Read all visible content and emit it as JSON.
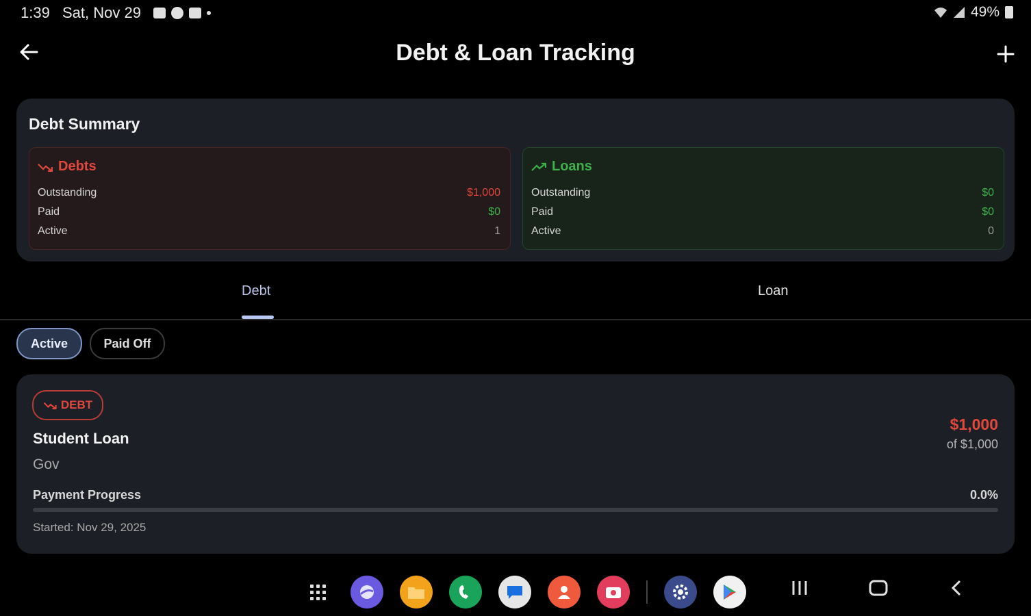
{
  "status_bar": {
    "time": "1:39",
    "date": "Sat, Nov 29",
    "battery": "49%"
  },
  "app_bar": {
    "title": "Debt & Loan Tracking",
    "back_icon": "arrow-left-icon",
    "add_icon": "plus-icon"
  },
  "summary": {
    "title": "Debt Summary",
    "debts": {
      "label": "Debts",
      "rows": [
        {
          "label": "Outstanding",
          "value": "$1,000"
        },
        {
          "label": "Paid",
          "value": "$0"
        },
        {
          "label": "Active",
          "value": "1"
        }
      ]
    },
    "loans": {
      "label": "Loans",
      "rows": [
        {
          "label": "Outstanding",
          "value": "$0"
        },
        {
          "label": "Paid",
          "value": "$0"
        },
        {
          "label": "Active",
          "value": "0"
        }
      ]
    }
  },
  "tabs": [
    "Debt",
    "Loan"
  ],
  "selected_tab": "Debt",
  "filters": [
    "Active",
    "Paid Off"
  ],
  "selected_filter": "Active",
  "debt_item": {
    "badge": "DEBT",
    "name": "Student Loan",
    "lender": "Gov",
    "amount": "$1,000",
    "of_total": "of $1,000",
    "progress_label": "Payment Progress",
    "progress_text": "0.0%",
    "progress_fraction": 0.0,
    "started": "Started: Nov 29, 2025"
  },
  "colors": {
    "debt_red": "#e0483d",
    "loan_green": "#3fb04c",
    "accent": "#7f96c6",
    "card_bg": "#1c1f26"
  },
  "dock_icons": [
    "app-drawer-icon",
    "browser-icon",
    "files-icon",
    "phone-icon",
    "messages-icon",
    "contacts-icon",
    "camera-icon",
    "settings-icon",
    "play-store-icon"
  ],
  "nav_icons": [
    "recents-icon",
    "home-icon",
    "back-icon"
  ]
}
